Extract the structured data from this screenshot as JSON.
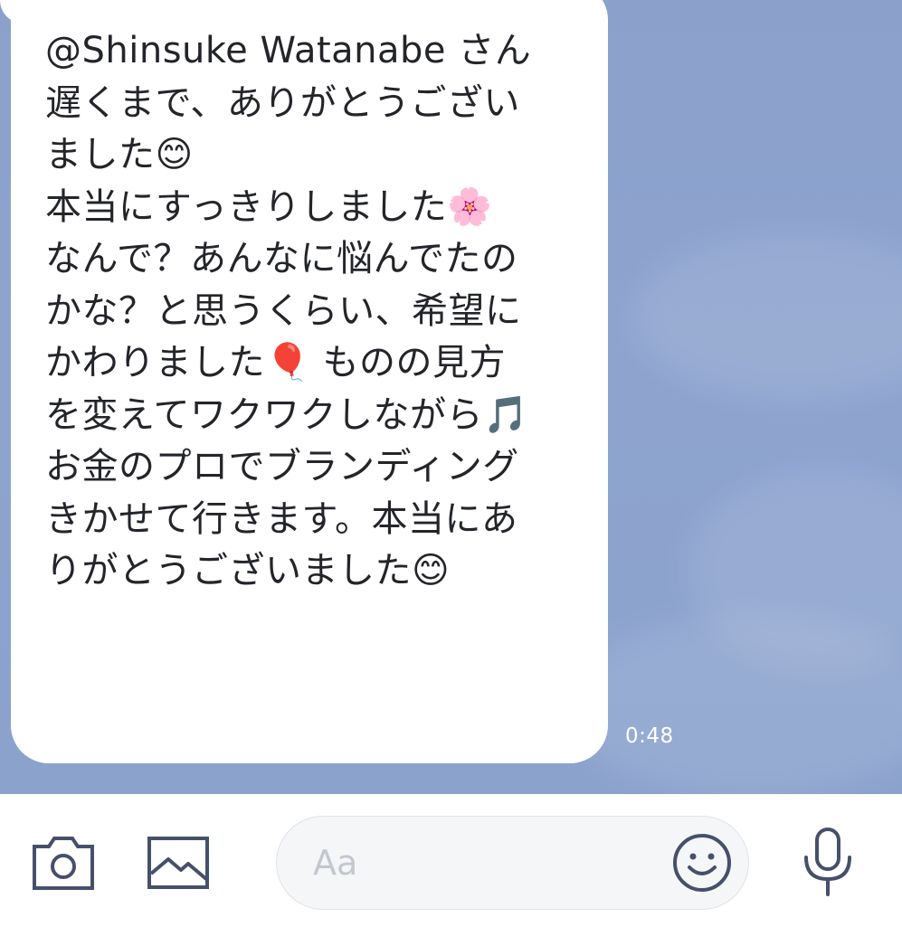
{
  "chat": {
    "message": {
      "mention": "@Shinsuke Watanabe",
      "text": "@Shinsuke Watanabe さん\n遅くまで、ありがとうござい\nました😊\n本当にすっきりしました🌸\nなんで？あんなに悩んでたの\nかな？と思うくらい、希望に\nかわりました🎈 ものの見方\nを変えてワクワクしながら🎵\nお金のプロでブランディング\nきかせて行きます。本当にあ\nりがとうございました😊",
      "time": "0:48"
    }
  },
  "input_bar": {
    "camera_icon": "camera-icon",
    "image_icon": "image-icon",
    "placeholder": "Aa",
    "emoji_icon": "smiley-icon",
    "mic_icon": "microphone-icon"
  },
  "colors": {
    "chat_background": "#8ca3ce",
    "bubble": "#ffffff",
    "text": "#23252a",
    "icon": "#46506a",
    "placeholder": "#c3c7cf"
  }
}
